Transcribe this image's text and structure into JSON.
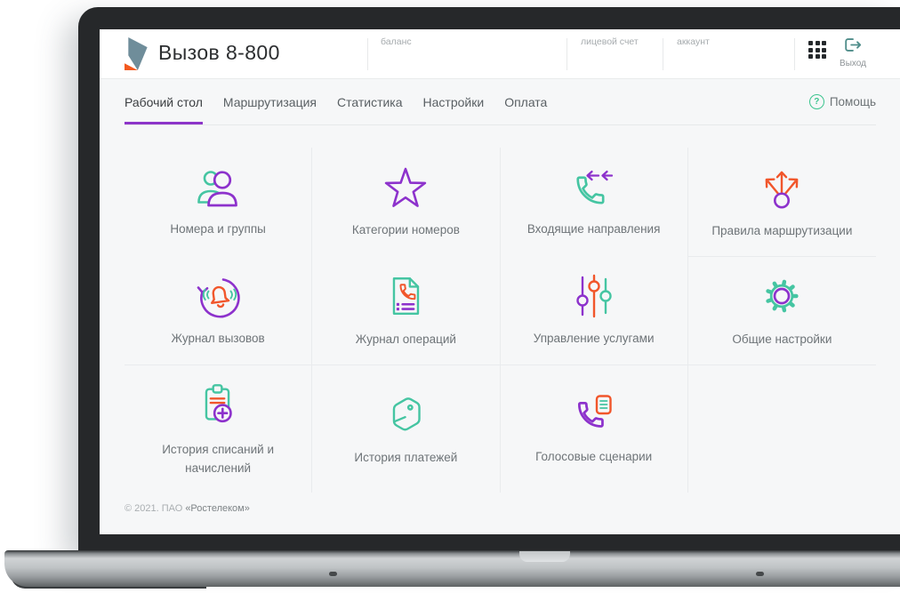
{
  "header": {
    "app_title": "Вызов 8-800",
    "fields": [
      {
        "label": "баланс",
        "value": ""
      },
      {
        "label": "лицевой счет",
        "value": ""
      },
      {
        "label": "аккаунт",
        "value": ""
      }
    ],
    "logout_label": "Выход"
  },
  "nav": {
    "tabs": [
      {
        "label": "Рабочий стол",
        "active": true
      },
      {
        "label": "Маршрутизация",
        "active": false
      },
      {
        "label": "Статистика",
        "active": false
      },
      {
        "label": "Настройки",
        "active": false
      },
      {
        "label": "Оплата",
        "active": false
      }
    ],
    "help_label": "Помощь"
  },
  "tiles": [
    {
      "label": "Номера и группы",
      "icon": "users-icon"
    },
    {
      "label": "Категории номеров",
      "icon": "star-icon"
    },
    {
      "label": "Входящие направления",
      "icon": "incoming-call-icon"
    },
    {
      "label": "Правила маршрутизации",
      "icon": "route-branch-icon"
    },
    {
      "label": "Журнал вызовов",
      "icon": "call-log-bell-icon"
    },
    {
      "label": "Журнал операций",
      "icon": "operations-document-icon"
    },
    {
      "label": "Управление услугами",
      "icon": "sliders-icon"
    },
    {
      "label": "Общие настройки",
      "icon": "gear-icon"
    },
    {
      "label": "История списаний и начислений",
      "icon": "clipboard-plus-icon"
    },
    {
      "label": "История платежей",
      "icon": "wallet-icon"
    },
    {
      "label": "Голосовые сценарии",
      "icon": "voice-script-icon"
    }
  ],
  "footer": {
    "copyright": "© 2021. ПАО",
    "company": "«Ростелеком»"
  },
  "colors": {
    "purple": "#8d32cc",
    "teal": "#45c5a2",
    "orange": "#f1562b",
    "help_green": "#3cc48e",
    "tab_underline": "#8d35c9",
    "logo_slate": "#6f8d9a",
    "logo_orange": "#f3591f",
    "logout_teal": "#4f8d8a"
  }
}
